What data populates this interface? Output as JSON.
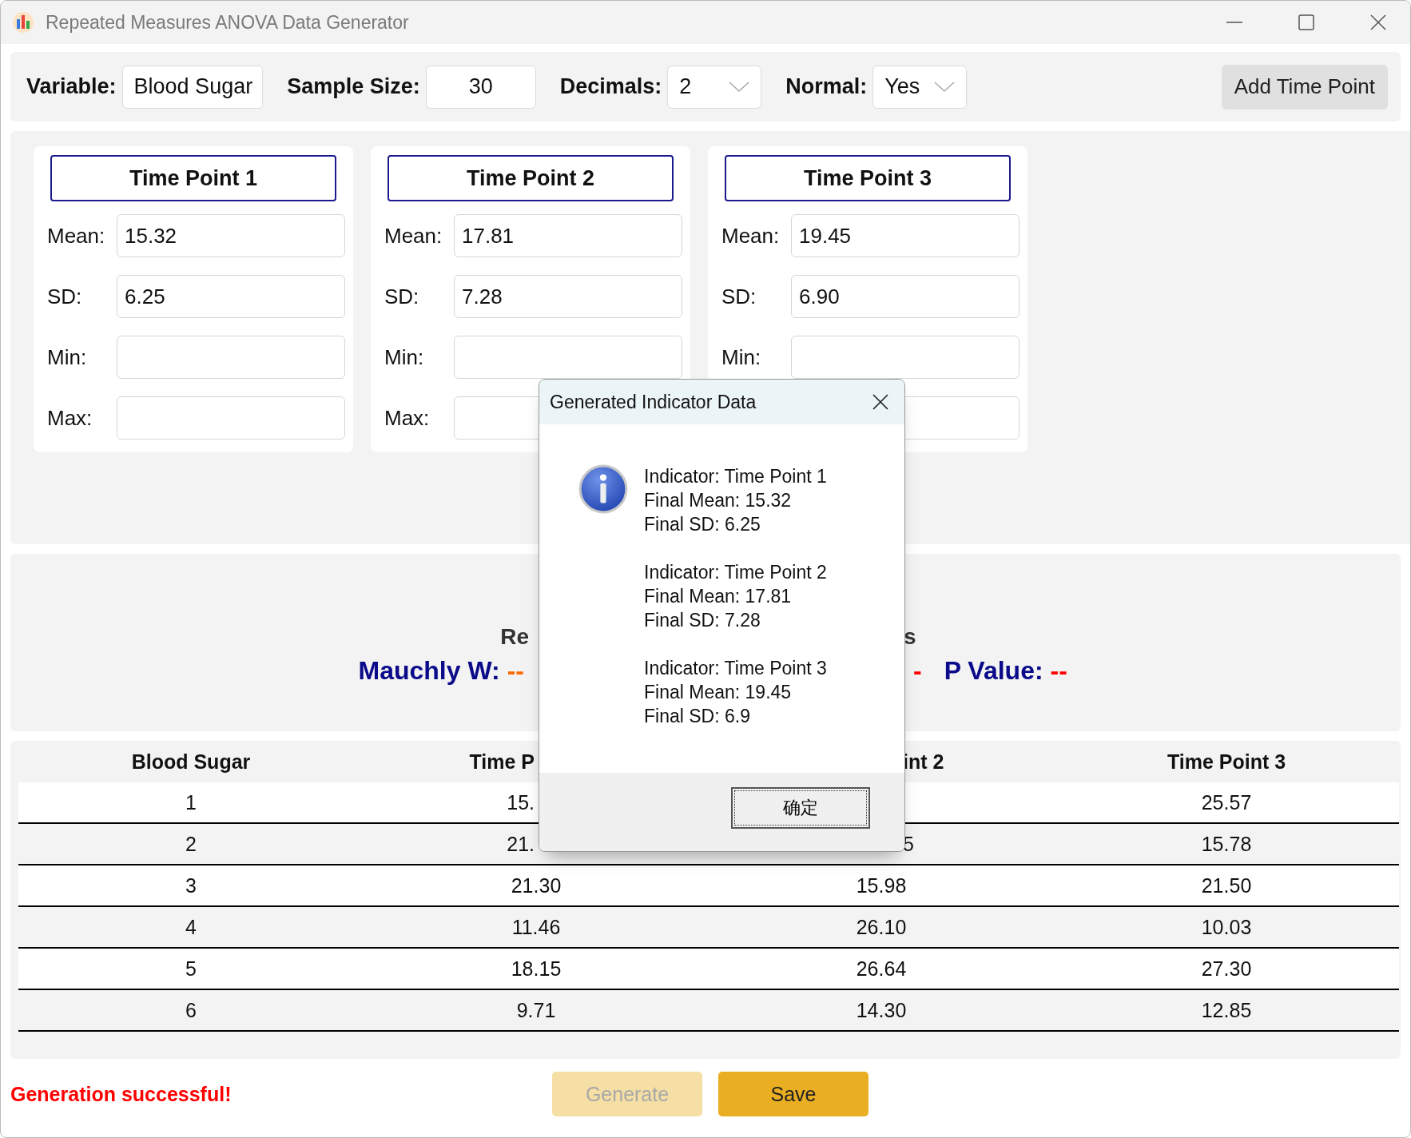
{
  "window": {
    "title": "Repeated Measures ANOVA Data Generator"
  },
  "toolbar": {
    "fields": [
      {
        "label": "Variable:",
        "value": "Blood Sugar",
        "kind": "text"
      },
      {
        "label": "Sample Size:",
        "value": "30",
        "kind": "number"
      },
      {
        "label": "Decimals:",
        "value": "2",
        "kind": "dropdown"
      },
      {
        "label": "Normal:",
        "value": "Yes",
        "kind": "dropdown"
      }
    ],
    "add_button": "Add Time Point"
  },
  "time_points": [
    {
      "title": "Time Point 1",
      "fields": [
        {
          "kind": "input",
          "label": "Mean:",
          "value": "15.32"
        },
        {
          "kind": "input",
          "label": "SD:",
          "value": "6.25"
        },
        {
          "kind": "input",
          "label": "Min:"
        },
        {
          "kind": "input",
          "label": "Max:"
        }
      ]
    },
    {
      "title": "Time Point 2",
      "fields": [
        {
          "kind": "input",
          "label": "Mean:",
          "value": "17.81"
        },
        {
          "kind": "input",
          "label": "SD:",
          "value": "7.28"
        },
        {
          "kind": "input",
          "label": "Min:"
        },
        {
          "kind": "input",
          "label": "Max:"
        }
      ]
    },
    {
      "title": "Time Point 3",
      "fields": [
        {
          "kind": "input",
          "label": "Mean:",
          "value": "19.45"
        },
        {
          "kind": "input",
          "label": "SD:",
          "value": "6.90"
        },
        {
          "kind": "input",
          "label": "Min:"
        },
        {
          "kind": "input"
        }
      ]
    }
  ],
  "results": {
    "title_left": "Re",
    "title_right": "s",
    "left_stats": [
      {
        "label": "Mauchly W:",
        "value": "--",
        "color": "#ff6a00"
      }
    ],
    "right_stats": [
      {
        "value": "-",
        "color": "#ff0000"
      },
      {
        "label": "P Value:",
        "value": "--",
        "color": "#ff0000"
      }
    ]
  },
  "table": {
    "columns": [
      "Blood Sugar",
      "Time P",
      "int 2",
      "Time Point 3"
    ],
    "rows": [
      [
        "1",
        "15.",
        null,
        "25.57"
      ],
      [
        "2",
        "21.",
        "5",
        "15.78"
      ],
      [
        "3",
        "21.30",
        "15.98",
        "21.50"
      ],
      [
        "4",
        "11.46",
        "26.10",
        "10.03"
      ],
      [
        "5",
        "18.15",
        "26.64",
        "27.30"
      ],
      [
        "6",
        "9.71",
        "14.30",
        "12.85"
      ]
    ]
  },
  "footer": {
    "status": "Generation successful!",
    "buttons": [
      {
        "label": "Generate",
        "disabled": true
      },
      {
        "label": "Save",
        "disabled": false
      }
    ]
  },
  "dialog": {
    "title": "Generated Indicator Data",
    "entries": [
      {
        "lines": [
          "Indicator: Time Point 1",
          "Final Mean: 15.32",
          "Final SD: 6.25"
        ]
      },
      {
        "lines": [
          "Indicator: Time Point 2",
          "Final Mean: 17.81",
          "Final SD: 7.28"
        ]
      },
      {
        "lines": [
          "Indicator: Time Point 3",
          "Final Mean: 19.45",
          "Final SD: 6.9"
        ]
      }
    ],
    "ok_button": "确定"
  }
}
